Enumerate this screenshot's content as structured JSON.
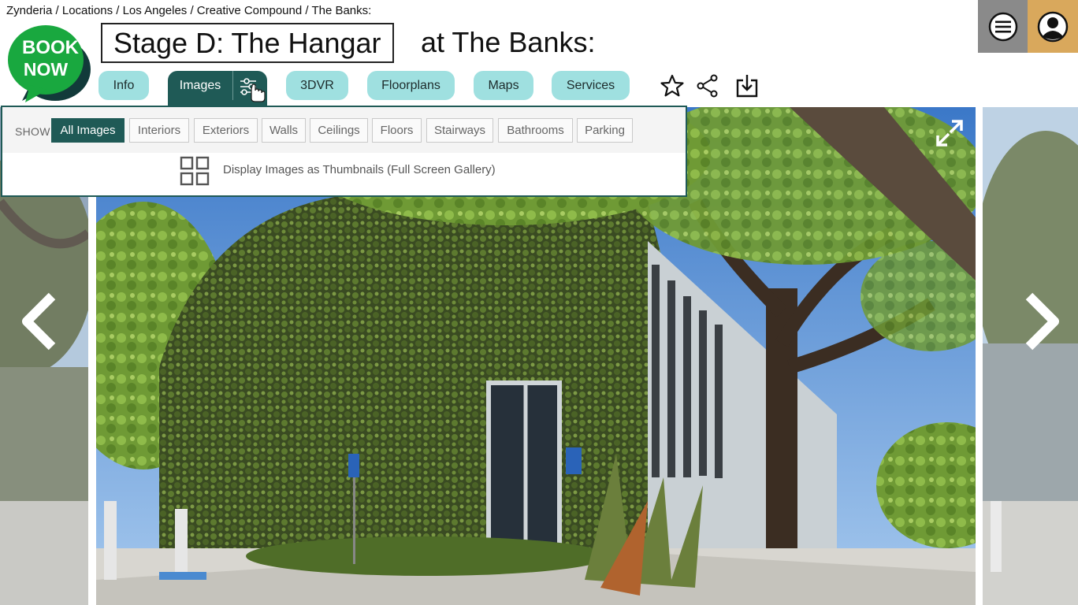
{
  "breadcrumb": "Zynderia / Locations / Los Angeles / Creative Compound / The Banks:",
  "logo": {
    "line1": "BOOK",
    "line2": "NOW"
  },
  "title": {
    "boxed": "Stage D: The Hangar",
    "suffix": "at The Banks:"
  },
  "tabs": [
    {
      "label": "Info"
    },
    {
      "label": "Images",
      "active": true
    },
    {
      "label": "3DVR"
    },
    {
      "label": "Floorplans"
    },
    {
      "label": "Maps"
    },
    {
      "label": "Services"
    }
  ],
  "actions": {
    "favorite_icon": "star-icon",
    "share_icon": "share-icon",
    "download_icon": "download-icon"
  },
  "header_buttons": {
    "menu_icon": "menu-icon",
    "user_icon": "user-icon"
  },
  "filter_panel": {
    "show_label": "SHOW",
    "chips": [
      "All Images",
      "Interiors",
      "Exteriors",
      "Walls",
      "Ceilings",
      "Floors",
      "Stairways",
      "Bathrooms",
      "Parking"
    ],
    "selected": "All Images",
    "thumbnail_link": "Display Images as Thumbnails  (Full Screen Gallery)"
  },
  "colors": {
    "accent": "#1f5a56",
    "tab": "#9fe0e0",
    "logo": "#19a83f",
    "user_bg": "#d9a85c",
    "menu_bg": "#8a8a8a"
  }
}
